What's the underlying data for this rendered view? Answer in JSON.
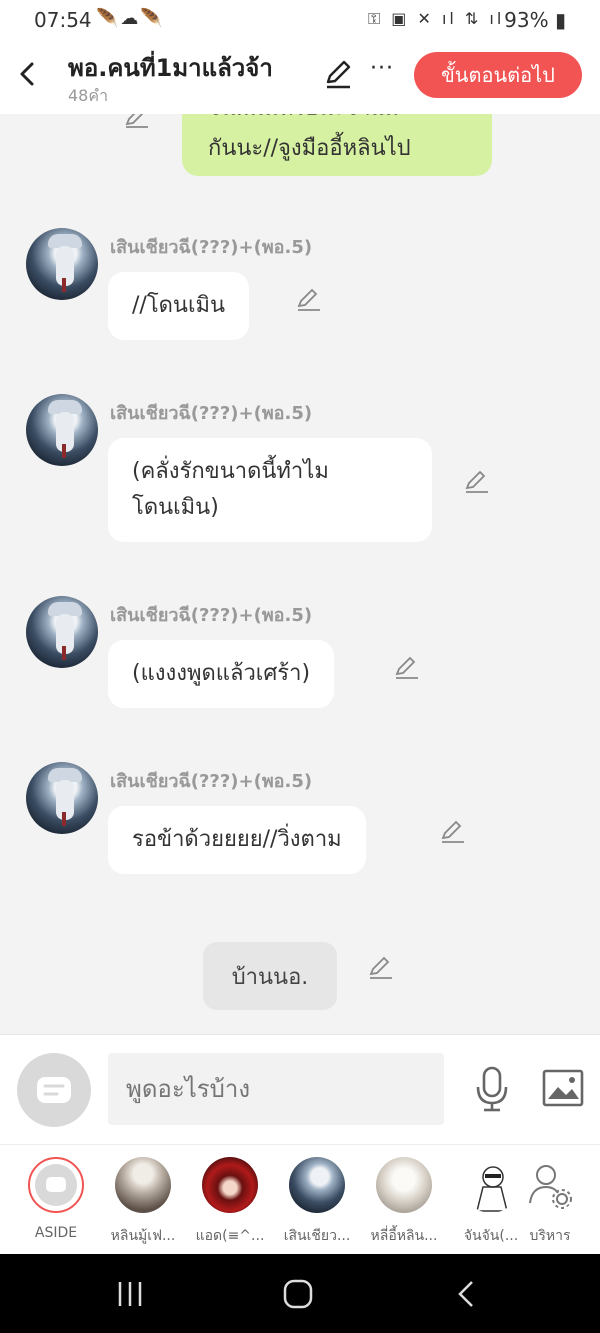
{
  "status": {
    "time": "07:54",
    "battery": "93%"
  },
  "header": {
    "title": "พอ.คนที่1มาแล้วจ้า",
    "subtitle": "48คำ",
    "next_label": "ขั้นตอนต่อไป",
    "more": "···"
  },
  "chat": {
    "top_bubble_line1": "จน...เมหรอนะจาแม",
    "top_bubble_line2": "กันนะ//จูงมืออี้หลินไป",
    "messages": [
      {
        "name": "เสินเชียวฉี(???)+(พอ.5)",
        "text": "//โดนเมิน"
      },
      {
        "name": "เสินเชียวฉี(???)+(พอ.5)",
        "text_line1": "(คลั่งรักขนาดนี้ทำไม",
        "text_line2": "โดนเมิน)"
      },
      {
        "name": "เสินเชียวฉี(???)+(พอ.5)",
        "text": "(แงงงพูดแล้วเศร้า)"
      },
      {
        "name": "เสินเชียวฉี(???)+(พอ.5)",
        "text": "รอข้าด้วยยยย//วิ่งตาม"
      }
    ],
    "narration": "บ้านนอ."
  },
  "input": {
    "placeholder": "พูดอะไรบ้าง"
  },
  "characters": [
    {
      "label": "ASIDE"
    },
    {
      "label": "หลินมู้เฟ..."
    },
    {
      "label": "แอด(≡^..."
    },
    {
      "label": "เสินเชียว..."
    },
    {
      "label": "หลี่อี้หลิน..."
    },
    {
      "label": "จันจัน(..."
    },
    {
      "label": "บริหาร"
    }
  ],
  "colors": {
    "accent": "#f25454",
    "green_bubble": "#d7f1a2"
  }
}
